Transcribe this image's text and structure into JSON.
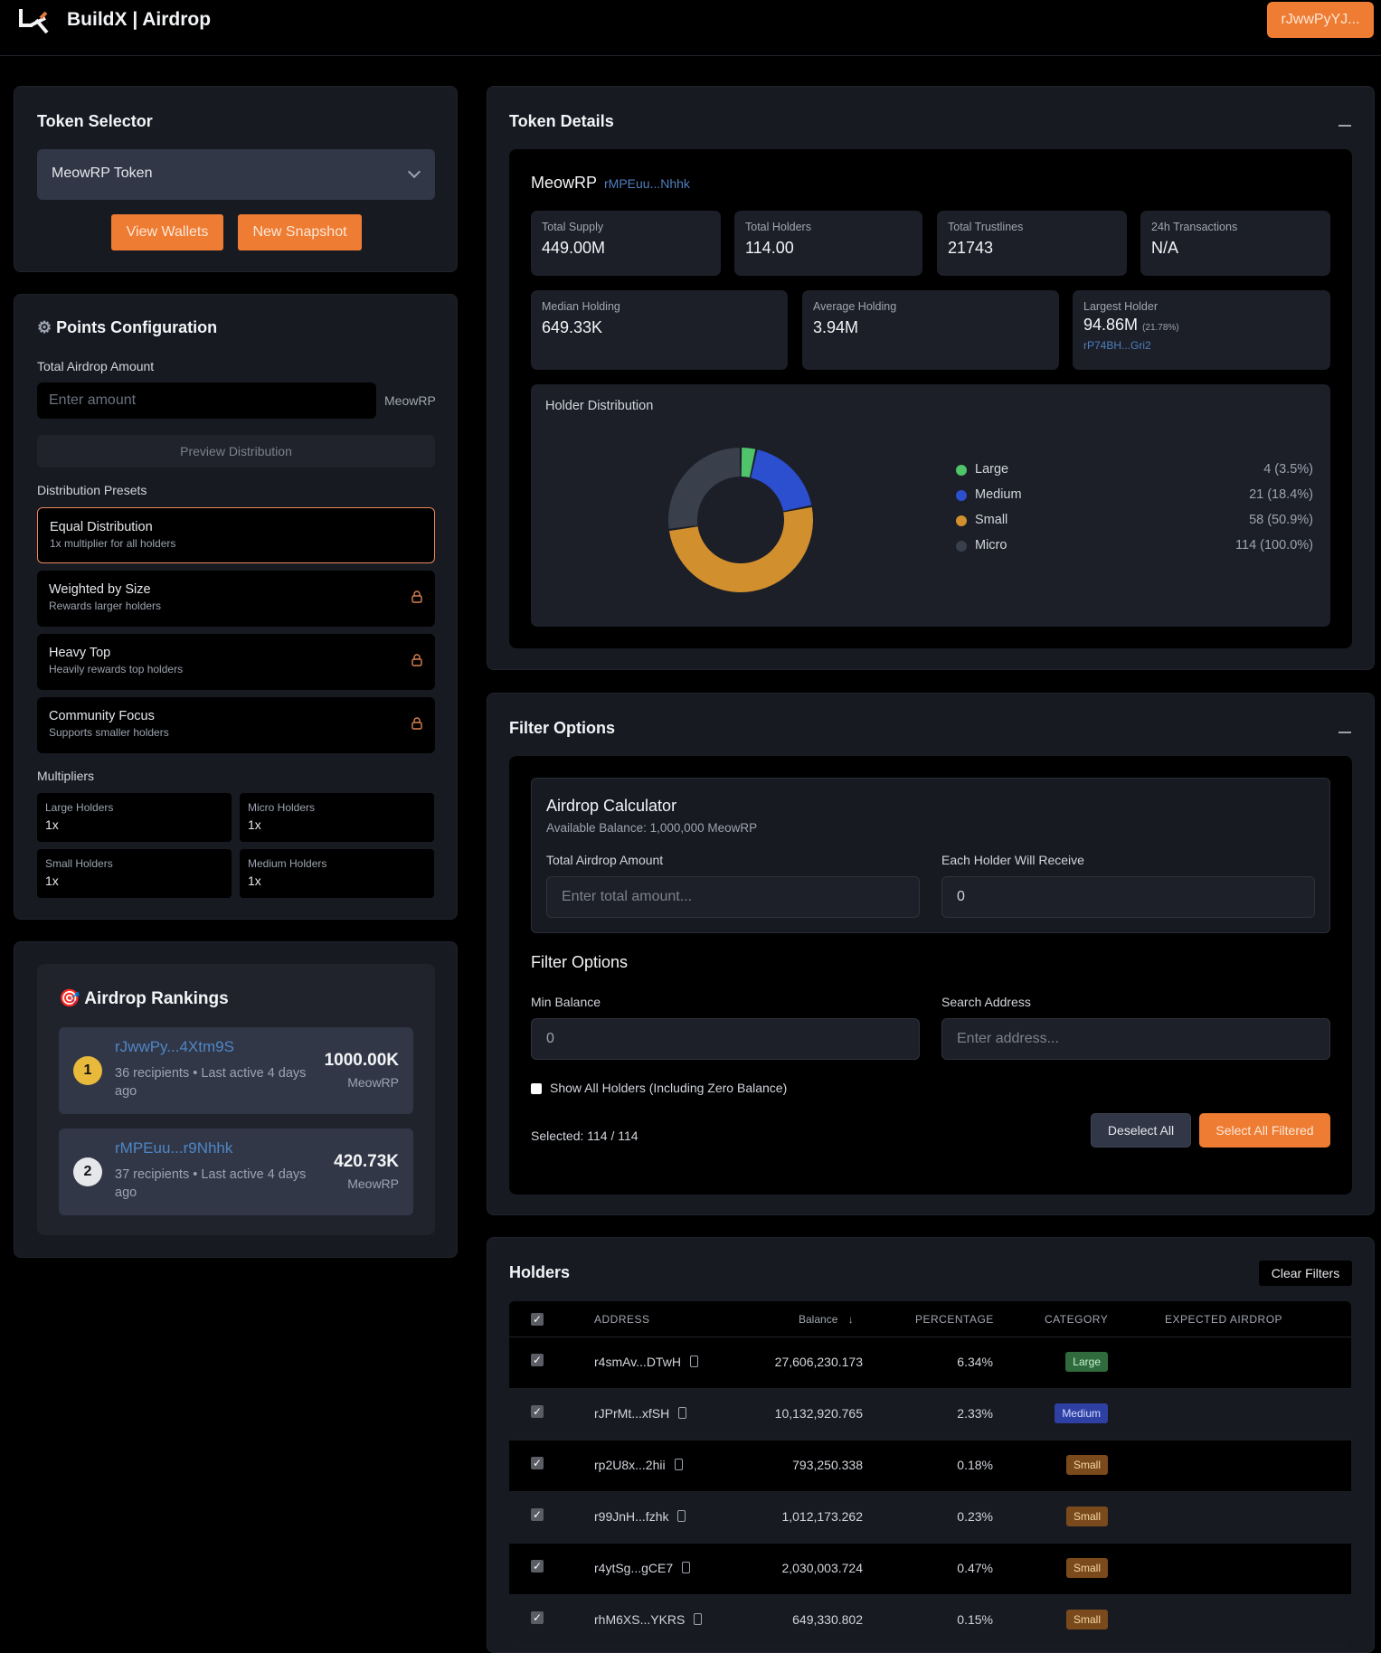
{
  "header": {
    "app_title": "BuildX | Airdrop",
    "wallet_button": "rJwwPyYJ..."
  },
  "token_selector": {
    "title": "Token Selector",
    "selected": "MeowRP Token",
    "view_wallets": "View Wallets",
    "new_snapshot": "New Snapshot"
  },
  "points_config": {
    "title": "Points Configuration",
    "icon": "gear-icon",
    "amount_label": "Total Airdrop Amount",
    "amount_placeholder": "Enter amount",
    "amount_unit": "MeowRP",
    "preview_button": "Preview Distribution",
    "presets_label": "Distribution Presets",
    "presets": [
      {
        "title": "Equal Distribution",
        "subtitle": "1x multiplier for all holders",
        "locked": false,
        "active": true
      },
      {
        "title": "Weighted by Size",
        "subtitle": "Rewards larger holders",
        "locked": true,
        "active": false
      },
      {
        "title": "Heavy Top",
        "subtitle": "Heavily rewards top holders",
        "locked": true,
        "active": false
      },
      {
        "title": "Community Focus",
        "subtitle": "Supports smaller holders",
        "locked": true,
        "active": false
      }
    ],
    "multipliers_label": "Multipliers",
    "multipliers": [
      {
        "label": "Large Holders",
        "value": "1x"
      },
      {
        "label": "Micro Holders",
        "value": "1x"
      },
      {
        "label": "Small Holders",
        "value": "1x"
      },
      {
        "label": "Medium Holders",
        "value": "1x"
      }
    ]
  },
  "rankings": {
    "title": "Airdrop Rankings",
    "icon": "target-icon",
    "items": [
      {
        "rank": "1",
        "address": "rJwwPy...4Xtm9S",
        "meta": "36 recipients • Last active 4 days ago",
        "amount": "1000.00K",
        "unit": "MeowRP",
        "badge_color": "#e8b93a"
      },
      {
        "rank": "2",
        "address": "rMPEuu...r9Nhhk",
        "meta": "37 recipients • Last active 4 days ago",
        "amount": "420.73K",
        "unit": "MeowRP",
        "badge_color": "#e5e7eb"
      }
    ]
  },
  "token_details": {
    "title": "Token Details",
    "token_name": "MeowRP",
    "token_address": "rMPEuu...Nhhk",
    "stats": [
      {
        "label": "Total Supply",
        "value": "449.00M"
      },
      {
        "label": "Total Holders",
        "value": "114.00"
      },
      {
        "label": "Total Trustlines",
        "value": "21743"
      },
      {
        "label": "24h Transactions",
        "value": "N/A"
      }
    ],
    "stats2": [
      {
        "label": "Median Holding",
        "value": "649.33K"
      },
      {
        "label": "Average Holding",
        "value": "3.94M"
      }
    ],
    "largest_holder": {
      "label": "Largest Holder",
      "value": "94.86M",
      "pct": "(21.78%)",
      "address": "rP74BH...Gri2"
    },
    "distribution_title": "Holder Distribution"
  },
  "chart_data": {
    "type": "pie",
    "title": "Holder Distribution",
    "donut": true,
    "categories": [
      "Large",
      "Medium",
      "Small",
      "Micro"
    ],
    "values": [
      4,
      21,
      58,
      114
    ],
    "percent_labels": [
      "4 (3.5%)",
      "21 (18.4%)",
      "58 (50.9%)",
      "114 (100.0%)"
    ],
    "colors": [
      "#4fc46b",
      "#2c4fd0",
      "#d18f2e",
      "#3a3f4c"
    ],
    "legend_position": "right"
  },
  "filter_panel": {
    "title": "Filter Options",
    "calculator": {
      "title": "Airdrop Calculator",
      "balance": "Available Balance: 1,000,000 MeowRP",
      "total_label": "Total Airdrop Amount",
      "total_placeholder": "Enter total amount...",
      "each_label": "Each Holder Will Receive",
      "each_value": "0"
    },
    "filters_title": "Filter Options",
    "min_balance_label": "Min Balance",
    "min_balance_value": "0",
    "search_label": "Search Address",
    "search_placeholder": "Enter address...",
    "show_all_label": "Show All Holders (Including Zero Balance)",
    "selected_text": "Selected: 114 / 114",
    "deselect_all": "Deselect All",
    "select_all_filtered": "Select All Filtered"
  },
  "holders": {
    "title": "Holders",
    "clear_filters": "Clear Filters",
    "columns": [
      "ADDRESS",
      "Balance",
      "PERCENTAGE",
      "CATEGORY",
      "EXPECTED AIRDROP"
    ],
    "rows": [
      {
        "address": "r4smAv...DTwH",
        "balance": "27,606,230.173",
        "percentage": "6.34%",
        "category": "Large"
      },
      {
        "address": "rJPrMt...xfSH",
        "balance": "10,132,920.765",
        "percentage": "2.33%",
        "category": "Medium"
      },
      {
        "address": "rp2U8x...2hii",
        "balance": "793,250.338",
        "percentage": "0.18%",
        "category": "Small"
      },
      {
        "address": "r99JnH...fzhk",
        "balance": "1,012,173.262",
        "percentage": "0.23%",
        "category": "Small"
      },
      {
        "address": "r4ytSg...gCE7",
        "balance": "2,030,003.724",
        "percentage": "0.47%",
        "category": "Small"
      },
      {
        "address": "rhM6XS...YKRS",
        "balance": "649,330.802",
        "percentage": "0.15%",
        "category": "Small"
      }
    ]
  }
}
